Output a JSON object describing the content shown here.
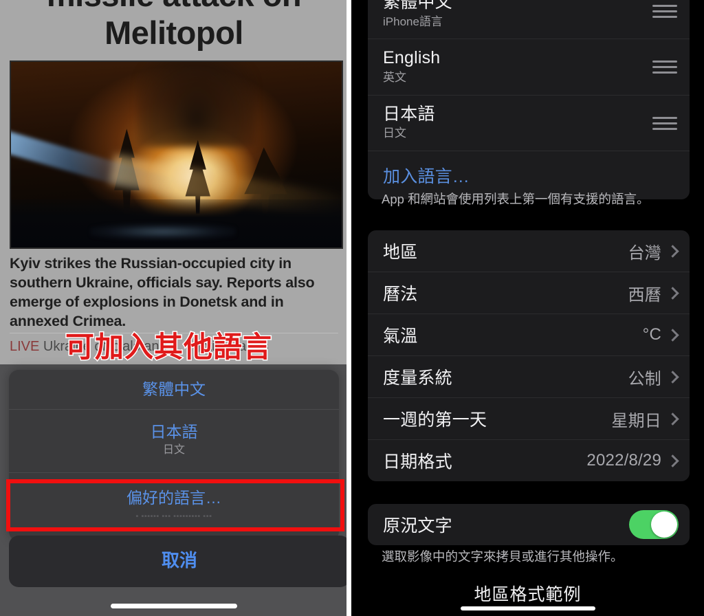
{
  "left_panel": {
    "article": {
      "title": "missile attack on\nMelitopol",
      "hero_image_alt": "night-time fire explosion with firefighter water jet",
      "standfirst": "Kyiv strikes the Russian-occupied city in southern Ukraine, officials say. Reports also emerge of explosions in Donetsk and in annexed Crimea.",
      "live_tag": "LIVE",
      "live_headline": "Ukraine officials and ... fighting rages"
    },
    "annotation": {
      "text": "可加入其他語言",
      "color": "#e01b1b",
      "outline_color": "#ffffff"
    },
    "action_sheet": {
      "rows": [
        {
          "primary": "繁體中文",
          "secondary": ""
        },
        {
          "primary": "日本語",
          "secondary": "日文"
        },
        {
          "primary": "偏好的語言…",
          "secondary": ""
        }
      ],
      "cancel_label": "取消",
      "highlight_color": "#f10f0f"
    }
  },
  "right_panel": {
    "language_group": {
      "rows": [
        {
          "name": "繁體中文",
          "sub": "iPhone語言",
          "handle": "reorder-handle"
        },
        {
          "name": "English",
          "sub": "英文",
          "handle": "reorder-handle"
        },
        {
          "name": "日本語",
          "sub": "日文",
          "handle": "reorder-handle"
        }
      ],
      "add_language_label": "加入語言…",
      "footnote": "App 和網站會使用列表上第一個有支援的語言。",
      "highlight_color": "#f10f0f"
    },
    "region_group": {
      "rows": [
        {
          "label": "地區",
          "value": "台灣"
        },
        {
          "label": "曆法",
          "value": "西曆"
        },
        {
          "label": "氣溫",
          "value": "°C"
        },
        {
          "label": "度量系統",
          "value": "公制"
        },
        {
          "label": "一週的第一天",
          "value": "星期日"
        },
        {
          "label": "日期格式",
          "value": "2022/8/29"
        }
      ]
    },
    "live_text": {
      "label": "原況文字",
      "toggle_state": "on",
      "toggle_color": "#4cd264",
      "footnote": "選取影像中的文字來拷貝或進行其他操作。"
    },
    "bottom_link_label": "地區格式範例"
  }
}
